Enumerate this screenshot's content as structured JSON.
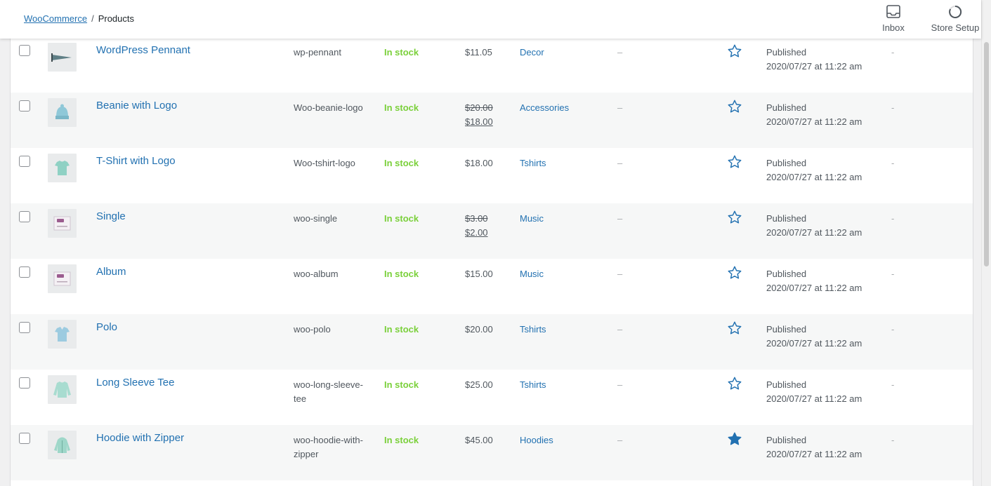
{
  "breadcrumb": {
    "parent": "WooCommerce",
    "separator": "/",
    "current": "Products"
  },
  "topbar": {
    "inbox_label": "Inbox",
    "inbox_icon": "inbox-icon",
    "setup_label": "Store Setup",
    "setup_icon": "progress-ring-icon"
  },
  "colors": {
    "link": "#2271b1",
    "in_stock": "#7ad03a",
    "star": "#2271b1"
  },
  "products": [
    {
      "name": "WordPress Pennant",
      "sku": "wp-pennant",
      "stock": "In stock",
      "price": "$11.05",
      "old_price": "",
      "sale_price": "",
      "category": "Decor",
      "tags": "–",
      "featured": false,
      "status": "Published",
      "date": "2020/07/27 at 11:22 am",
      "extra": "-",
      "thumb": "pennant"
    },
    {
      "name": "Beanie with Logo",
      "sku": "Woo-beanie-logo",
      "stock": "In stock",
      "price": "",
      "old_price": "$20.00",
      "sale_price": "$18.00",
      "category": "Accessories",
      "tags": "–",
      "featured": false,
      "status": "Published",
      "date": "2020/07/27 at 11:22 am",
      "extra": "-",
      "thumb": "beanie"
    },
    {
      "name": "T-Shirt with Logo",
      "sku": "Woo-tshirt-logo",
      "stock": "In stock",
      "price": "$18.00",
      "old_price": "",
      "sale_price": "",
      "category": "Tshirts",
      "tags": "–",
      "featured": false,
      "status": "Published",
      "date": "2020/07/27 at 11:22 am",
      "extra": "-",
      "thumb": "tshirt"
    },
    {
      "name": "Single",
      "sku": "woo-single",
      "stock": "In stock",
      "price": "",
      "old_price": "$3.00",
      "sale_price": "$2.00",
      "category": "Music",
      "tags": "–",
      "featured": false,
      "status": "Published",
      "date": "2020/07/27 at 11:22 am",
      "extra": "-",
      "thumb": "music"
    },
    {
      "name": "Album",
      "sku": "woo-album",
      "stock": "In stock",
      "price": "$15.00",
      "old_price": "",
      "sale_price": "",
      "category": "Music",
      "tags": "–",
      "featured": false,
      "status": "Published",
      "date": "2020/07/27 at 11:22 am",
      "extra": "-",
      "thumb": "music"
    },
    {
      "name": "Polo",
      "sku": "woo-polo",
      "stock": "In stock",
      "price": "$20.00",
      "old_price": "",
      "sale_price": "",
      "category": "Tshirts",
      "tags": "–",
      "featured": false,
      "status": "Published",
      "date": "2020/07/27 at 11:22 am",
      "extra": "-",
      "thumb": "polo"
    },
    {
      "name": "Long Sleeve Tee",
      "sku": "woo-long-sleeve-tee",
      "stock": "In stock",
      "price": "$25.00",
      "old_price": "",
      "sale_price": "",
      "category": "Tshirts",
      "tags": "–",
      "featured": false,
      "status": "Published",
      "date": "2020/07/27 at 11:22 am",
      "extra": "-",
      "thumb": "longsleeve"
    },
    {
      "name": "Hoodie with Zipper",
      "sku": "woo-hoodie-with-zipper",
      "stock": "In stock",
      "price": "$45.00",
      "old_price": "",
      "sale_price": "",
      "category": "Hoodies",
      "tags": "–",
      "featured": true,
      "status": "Published",
      "date": "2020/07/27 at 11:22 am",
      "extra": "-",
      "thumb": "hoodie"
    }
  ]
}
